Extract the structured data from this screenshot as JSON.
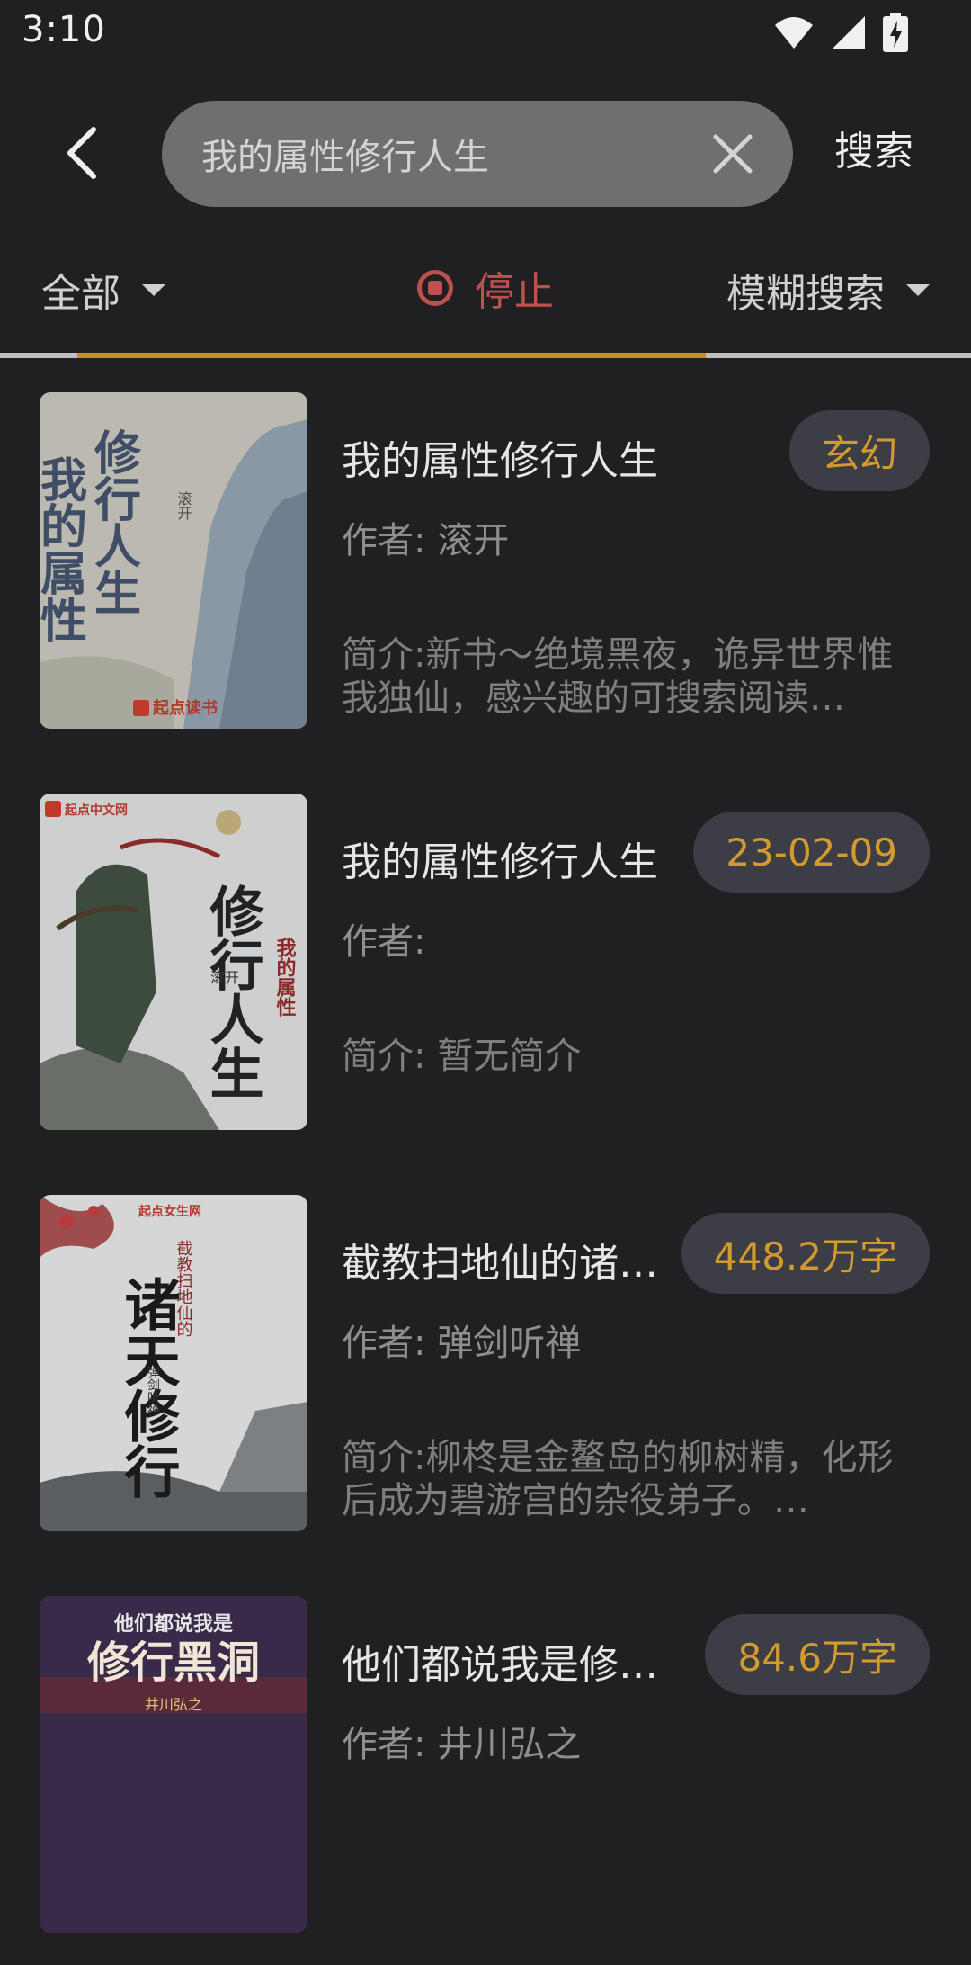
{
  "status": {
    "time": "3:10",
    "icons": [
      "wifi-icon",
      "signal-icon",
      "battery-charging-icon"
    ]
  },
  "header": {
    "search_value": "我的属性修行人生",
    "search_action": "搜索"
  },
  "filters": {
    "scope": "全部",
    "stop": "停止",
    "mode": "模糊搜索"
  },
  "progress": 0.77,
  "colors": {
    "background": "#202023",
    "accent": "#d18a1e",
    "stop": "#c0504d",
    "tag_bg": "#3d3d45",
    "tag_text": "#d39a2e"
  },
  "books": [
    {
      "title": "我的属性修行人生",
      "tag": "玄幻",
      "author": "作者: 滚开",
      "intro": "简介:新书～绝境黑夜，诡异世界惟我独仙，感兴趣的可搜索阅读…",
      "cover": {
        "title_left": "我的属性",
        "title_right": "修行人生",
        "author": "滚开",
        "publisher": "起点读书"
      }
    },
    {
      "title": "我的属性修行人生",
      "tag": "23-02-09",
      "author": "作者:",
      "intro": "简介: 暂无简介",
      "cover": {
        "publisher": "起点中文网",
        "title": "修行人生",
        "subtitle": "我的属性",
        "author": "滚开"
      }
    },
    {
      "title": "截教扫地仙的诸…",
      "tag": "448.2万字",
      "author": "作者: 弹剑听禅",
      "intro": "简介:柳柊是金鳌岛的柳树精，化形后成为碧游宫的杂役弟子。…",
      "cover": {
        "publisher": "起点女生网",
        "small_title": "截教扫地仙的",
        "title": "诸天修行",
        "author": "弹剑听禅"
      }
    },
    {
      "title": "他们都说我是修…",
      "tag": "84.6万字",
      "author": "作者: 井川弘之",
      "intro": "",
      "cover": {
        "small_title": "他们都说我是",
        "title": "修行黑洞",
        "author": "井川弘之"
      }
    }
  ]
}
